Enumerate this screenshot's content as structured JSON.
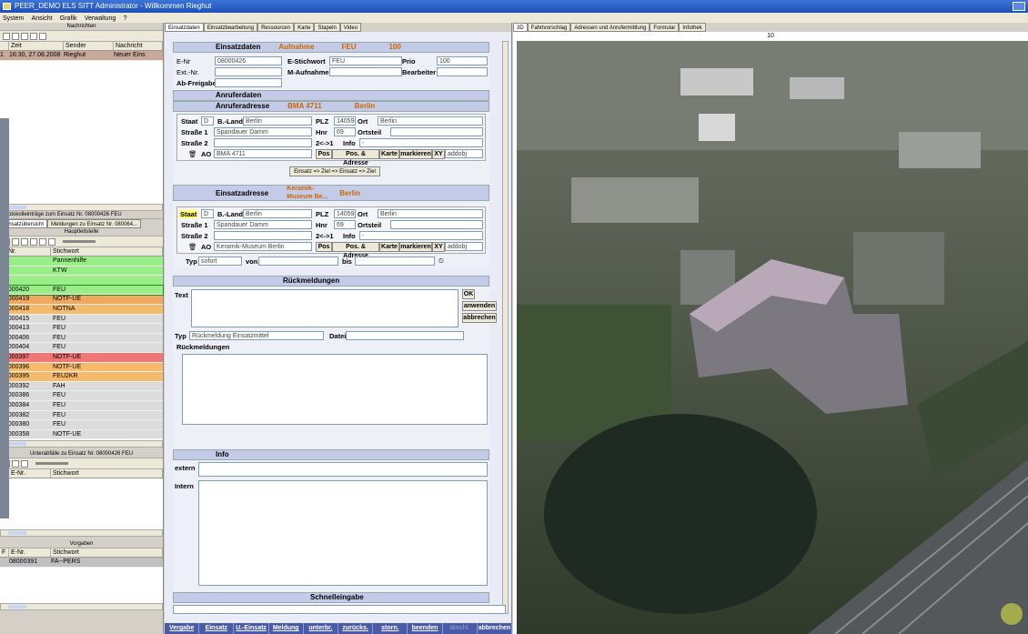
{
  "window": {
    "title": "PEER_DEMO ELS SITT Administrator - Willkommen Rieghut"
  },
  "menu": [
    "System",
    "Ansicht",
    "Grafik",
    "Verwaltung",
    "?"
  ],
  "left": {
    "messages": {
      "title": "Nachrichten",
      "columns": [
        "Zeit",
        "Sender",
        "Nachricht"
      ],
      "rows": [
        {
          "nr": "1",
          "zeit": "16:30, 27.08.2008",
          "sender": "Rieghut",
          "nachricht": "Neuer Eins"
        }
      ]
    },
    "protocol_title": "Protokolleinträge zum Einsatz Nr. 08000426 FEU",
    "tabs": [
      "Einsatzübersicht",
      "Meldungen zu Einsatz Nr. 080064..."
    ],
    "incidents": {
      "title": "Hauptleitstelle",
      "columns": [
        "E-Nr.",
        "Stichwort"
      ],
      "rows": [
        {
          "nr": "",
          "stw": "Pannenhilfe",
          "color": "#99ee88"
        },
        {
          "nr": "",
          "stw": "KTW",
          "color": "#99ee88"
        },
        {
          "nr": "",
          "stw": "",
          "color": "#99ee88"
        },
        {
          "nr": "08000420",
          "stw": "FEU",
          "color": "#99ee88"
        },
        {
          "nr": "08000419",
          "stw": "NOTF-UE",
          "color": "#f0a860"
        },
        {
          "nr": "08000418",
          "stw": "NOTNA",
          "color": "#f5bb6a"
        },
        {
          "nr": "08000415",
          "stw": "FEU",
          "color": "#dcdcdc"
        },
        {
          "nr": "08000413",
          "stw": "FEU",
          "color": "#dcdcdc"
        },
        {
          "nr": "08000406",
          "stw": "FEU",
          "color": "#dcdcdc"
        },
        {
          "nr": "08000404",
          "stw": "FEU",
          "color": "#dcdcdc"
        },
        {
          "nr": "08000397",
          "stw": "NOTF-UE",
          "color": "#ee7777"
        },
        {
          "nr": "08000396",
          "stw": "NOTF-UE",
          "color": "#f5bb6a"
        },
        {
          "nr": "08000395",
          "stw": "FEU2KR",
          "color": "#f5bb6a"
        },
        {
          "nr": "08000392",
          "stw": "FAH",
          "color": "#dcdcdc"
        },
        {
          "nr": "08000386",
          "stw": "FEU",
          "color": "#dcdcdc"
        },
        {
          "nr": "08000384",
          "stw": "FEU",
          "color": "#dcdcdc"
        },
        {
          "nr": "08000382",
          "stw": "FEU",
          "color": "#dcdcdc"
        },
        {
          "nr": "08000380",
          "stw": "FEU",
          "color": "#dcdcdc"
        },
        {
          "nr": "08000358",
          "stw": "NOTF-UE",
          "color": "#dcdcdc"
        }
      ]
    },
    "sub_title": "Unterabfälle zu Einsatz Nr. 08000426 FEU",
    "sub_columns": [
      "F",
      "E-Nr.",
      "Stichwort"
    ],
    "vorgaben": {
      "title": "Vorgaben",
      "columns": [
        "F",
        "E-Nr.",
        "Stichwort"
      ],
      "rows": [
        {
          "nr": "08000391",
          "stw": "FA--PERS"
        }
      ]
    }
  },
  "mid": {
    "tabs": [
      "Einsatzdaten",
      "Einsatzbearbeitung",
      "Ressourcen",
      "Karte",
      "Stapeln",
      "Video"
    ],
    "einsatz": {
      "header": "Einsatzdaten",
      "header_status": "Aufnahme",
      "header_type": "FEU",
      "header_prio": "100",
      "enr_label": "E-Nr",
      "enr": "08000426",
      "stw_label": "E-Stichwort",
      "stw": "FEU",
      "prio_label": "Prio",
      "prio": "100",
      "extnr_label": "Ext.-Nr.",
      "maufnahme_label": "M-Aufnahme",
      "bearbeiter_label": "Bearbeiter",
      "abfreigabe_label": "Ab-Freigabe"
    },
    "anrufer": {
      "header": "Anruferdaten",
      "addr_label": "Anruferadresse",
      "addr_name": "BMA 4711",
      "addr_city": "Berlin",
      "staat_label": "Staat",
      "staat": "D",
      "land_label": "B.-Land",
      "land": "Berlin",
      "plz_label": "PLZ",
      "plz": "14059",
      "ort_label": "Ort",
      "ort": "Berlin",
      "str1_label": "Straße 1",
      "str1": "Spandauer Damm",
      "hnr_label": "Hnr",
      "hnr": "69",
      "ortsteil_label": "Ortsteil",
      "str2_label": "Straße 2",
      "swap_label": "2<->1",
      "info_label": "Info",
      "info": "-",
      "ao_label": "AO",
      "ao": "BMA 4711",
      "pos_label": "Pos",
      "posadr_label": "Pos. & Adresse",
      "karte_label": "Karte",
      "markieren_label": "markieren",
      "xy_label": "XY",
      "xy": "addobj",
      "copy_label": "Einsatz => Ziel => Einsatz => Ziel"
    },
    "einsatzadr": {
      "addr_label": "Einsatzadresse",
      "addr_name": "Keramik-Museum Be...",
      "addr_city": "Berlin",
      "staat": "D",
      "land": "Berlin",
      "plz": "14059",
      "ort": "Berlin",
      "str1": "Spandauer Damm",
      "hnr": "69",
      "info": "-",
      "ao": "Keramik-Museum Berlin",
      "xy": "addobj"
    },
    "typ": {
      "typ_label": "Typ",
      "typ_value": "sofort",
      "von_label": "von",
      "bis_label": "bis"
    },
    "rueck": {
      "header": "Rückmeldungen",
      "text_label": "Text",
      "ok": "OK",
      "anwenden": "anwenden",
      "abbrechen": "abbrechen",
      "typ_label": "Typ",
      "typ_value": "Rückmeldung Einsatzmittel",
      "datei_label": "Datei",
      "group_label": "Rückmeldungen"
    },
    "info": {
      "header": "Info",
      "extern_label": "extern",
      "intern_label": "Intern"
    },
    "schnell": {
      "header": "Schnelleingabe"
    },
    "buttons": [
      "Vergabe",
      "Einsatz",
      "U.-Einsatz",
      "Meldung",
      "unterbr.",
      "zurücks.",
      "storn.",
      "beenden",
      "abschl.",
      "abbrechen"
    ]
  },
  "right": {
    "tabs": [
      "3D",
      "Fahrtvorschlag",
      "Adressen und Anrufermittlung",
      "Formular",
      "Infothek"
    ],
    "map_label": "10"
  }
}
